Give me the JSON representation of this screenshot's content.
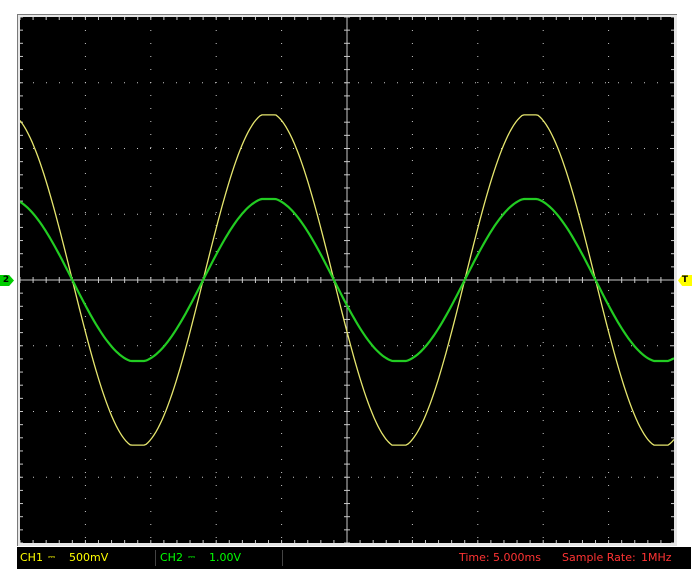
{
  "markers": {
    "ch2": "2",
    "trigger": "T"
  },
  "colors": {
    "background": "#000000",
    "grid": "#c8c8c8",
    "ch1": "#e6e66e",
    "ch2": "#22cc22",
    "time_text": "#ff3333"
  },
  "status": {
    "ch1_label": "CH1",
    "ch1_coupling": "⎓",
    "ch1_scale": "500mV",
    "ch2_label": "CH2",
    "ch2_coupling": "⎓",
    "ch2_scale": "1.00V",
    "time_label": "Time:",
    "time_value": "5.000ms",
    "sample_label": "Sample Rate:",
    "sample_value": "1MHz"
  },
  "chart_data": {
    "type": "line",
    "grid": true,
    "x_divisions": 10,
    "y_divisions": 8,
    "series": [
      {
        "color": "#e6e66e",
        "amplitude_div": 2.55,
        "period_div": 4.0,
        "phase_div_at_zero": -1.2
      },
      {
        "color": "#22cc22",
        "amplitude_div": 1.25,
        "period_div": 4.0,
        "phase_div_at_zero": -1.2
      }
    ]
  }
}
